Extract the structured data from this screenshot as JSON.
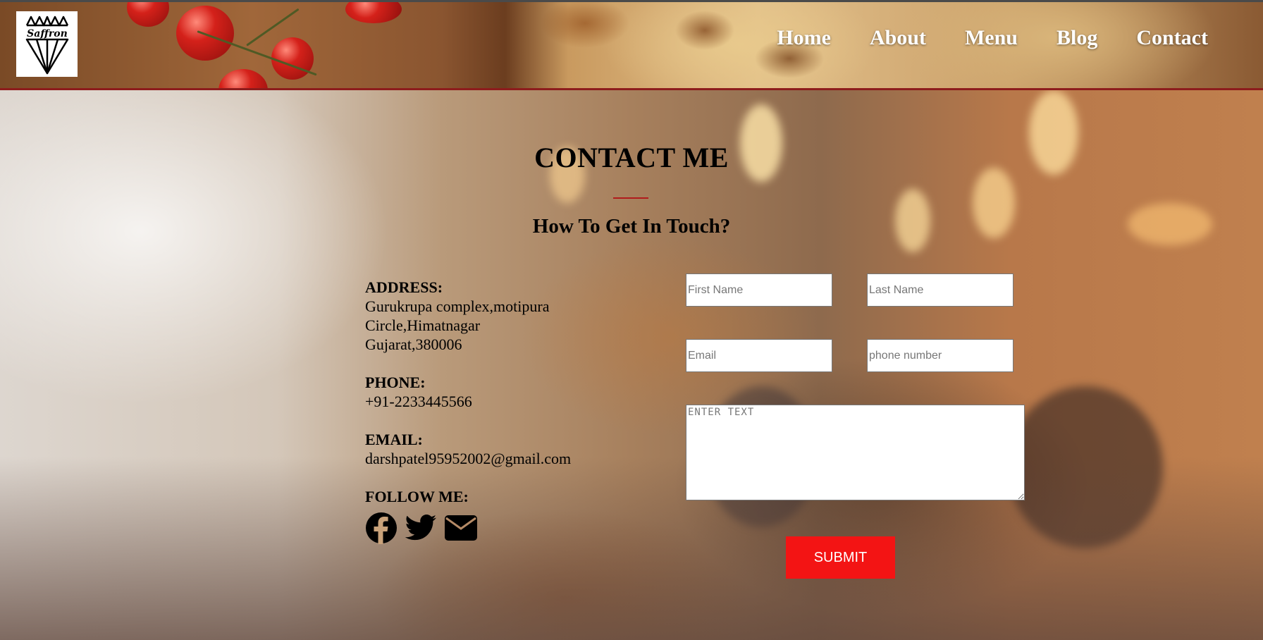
{
  "brand": {
    "logo_text": "Saffron"
  },
  "nav": {
    "items": [
      {
        "label": "Home"
      },
      {
        "label": "About"
      },
      {
        "label": "Menu"
      },
      {
        "label": "Blog"
      },
      {
        "label": "Contact"
      }
    ]
  },
  "contact": {
    "title": "CONTACT ME",
    "subtitle": "How To Get In Touch?",
    "address_label": "ADDRESS:",
    "address_lines": [
      "Gurukrupa complex,motipura",
      "Circle,Himatnagar",
      "Gujarat,380006"
    ],
    "phone_label": "PHONE:",
    "phone": "+91-2233445566",
    "email_label": "EMAIL:",
    "email": "darshpatel95952002@gmail.com",
    "follow_label": "FOLLOW ME:",
    "socials": [
      "facebook-icon",
      "twitter-icon",
      "mail-icon"
    ]
  },
  "form": {
    "first_name_placeholder": "First Name",
    "last_name_placeholder": "Last Name",
    "email_placeholder": "Email",
    "phone_placeholder": "phone number",
    "message_placeholder": "ENTER TEXT",
    "submit_label": "SUBMIT"
  },
  "colors": {
    "accent": "#f31414",
    "rule": "#b11b1b",
    "header_border": "#8d1c1c"
  }
}
